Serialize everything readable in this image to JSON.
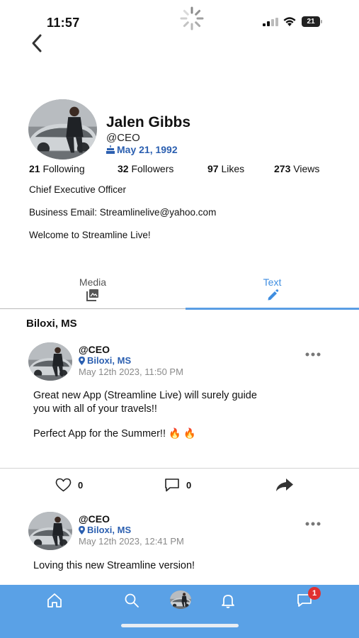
{
  "status_bar": {
    "time": "11:57",
    "battery": "21"
  },
  "profile": {
    "name": "Jalen Gibbs",
    "handle": "@CEO",
    "birthday": "May 21, 1992",
    "stats": [
      {
        "count": "21",
        "label": "Following"
      },
      {
        "count": "32",
        "label": "Followers"
      },
      {
        "count": "97",
        "label": "Likes"
      },
      {
        "count": "273",
        "label": "Views"
      }
    ],
    "bio": [
      "Chief Executive Officer",
      "Business Email: Streamlinelive@yahoo.com",
      "Welcome to Streamline Live!"
    ]
  },
  "tabs": [
    {
      "label": "Media",
      "icon": "image-icon",
      "active": false
    },
    {
      "label": "Text",
      "icon": "pencil-icon",
      "active": true
    }
  ],
  "location_header": "Biloxi, MS",
  "posts": [
    {
      "handle": "@CEO",
      "location": "Biloxi, MS",
      "time": "May 12th 2023, 11:50 PM",
      "lines": [
        "Great new App (Streamline Live) will surely guide",
        "you with all of your travels!!",
        "Perfect App for the Summer!!"
      ],
      "emoji": "🔥 🔥",
      "likes": "0",
      "comments": "0"
    },
    {
      "handle": "@CEO",
      "location": "Biloxi, MS",
      "time": "May 12th 2023, 12:41 PM",
      "lines": [
        "Loving this new Streamline version!"
      ]
    }
  ],
  "bottom_nav": {
    "items": [
      "home-icon",
      "search-icon",
      "avatar",
      "bell-icon",
      "chat-icon"
    ],
    "badge": "1"
  },
  "colors": {
    "accent": "#2b5fb0",
    "tab_active": "#3f8ee0",
    "nav_bg": "#5aa1e6",
    "badge": "#e03131"
  }
}
